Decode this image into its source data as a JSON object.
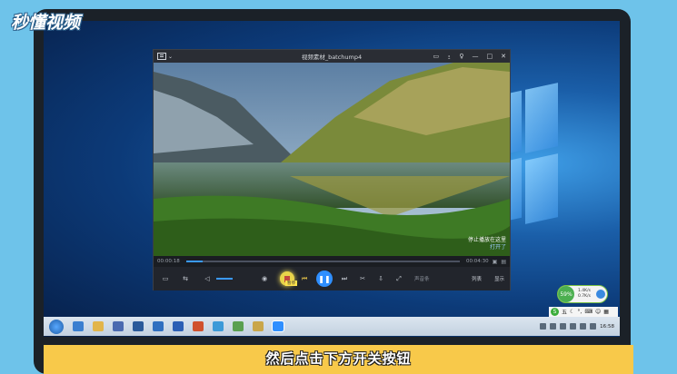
{
  "watermark": {
    "logo_text": "秒懂视频"
  },
  "player": {
    "title": "视频素材_batchump4",
    "window_controls": [
      "▭",
      "⍛",
      "♀",
      "—",
      "□",
      "✕"
    ],
    "overlay": {
      "line1": "停止播放在这里",
      "line2": "打开了"
    },
    "time_current": "00:00:18",
    "time_total": "00:04:30",
    "progress_fraction": 0.06,
    "control_labels": {
      "audio": "声音条",
      "playlist": "列表",
      "more": "显示"
    },
    "tooltip": "暂停"
  },
  "tray": {
    "net_percent": "59%",
    "upload": "1.4K/s",
    "download": "0.7K/s",
    "ime_label": "五",
    "clock": "16:58"
  },
  "subtitle": "然后点击下方开关按钮"
}
